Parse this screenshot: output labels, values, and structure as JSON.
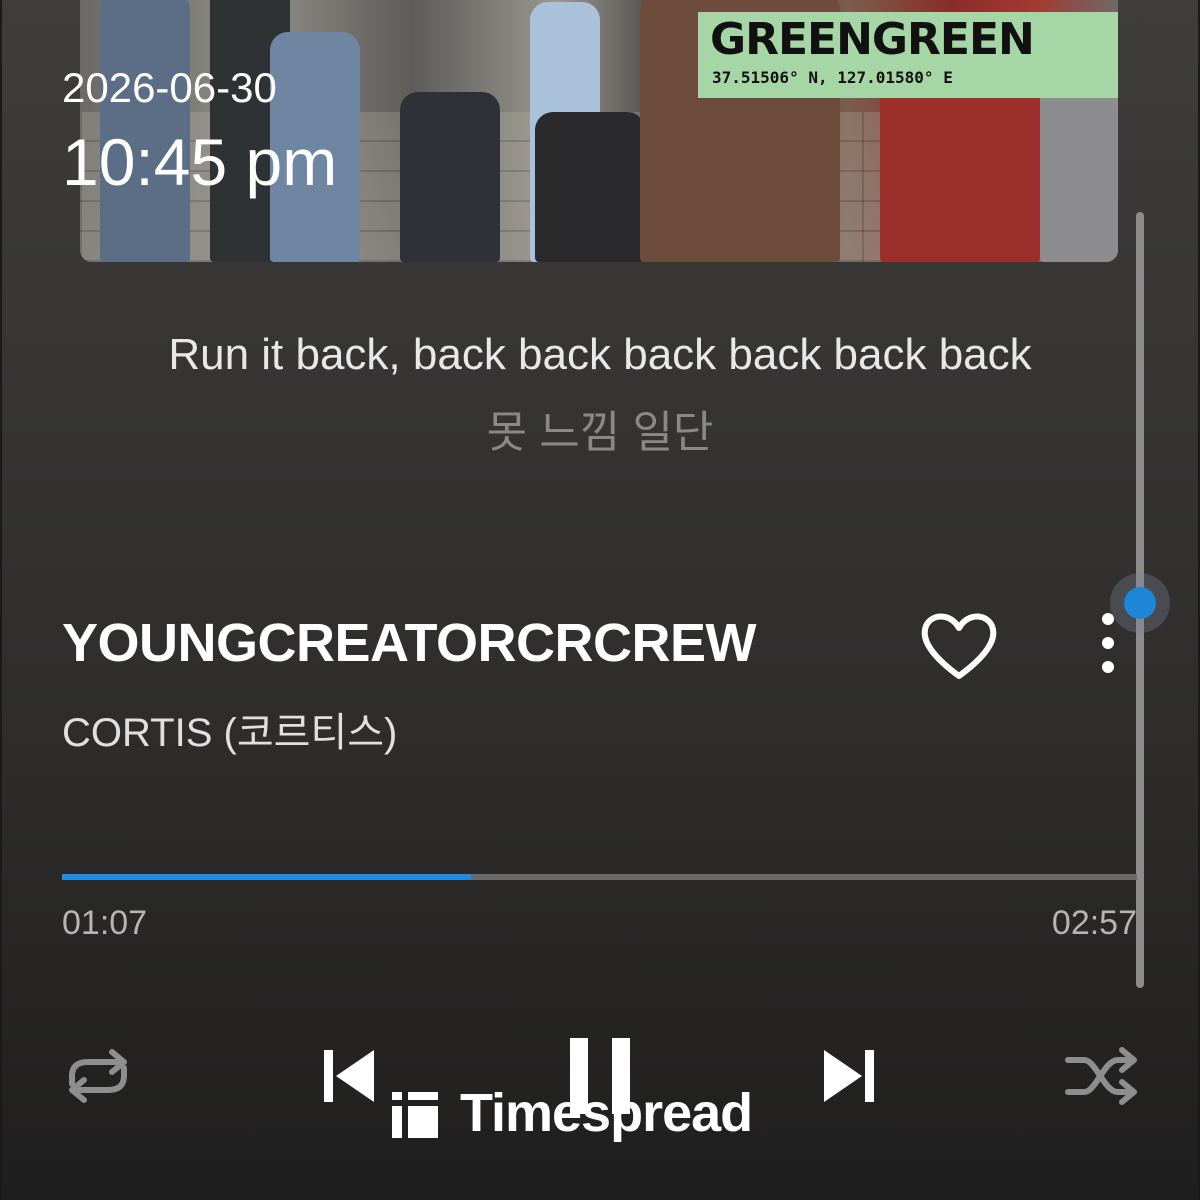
{
  "status": {
    "date": "2026-06-30",
    "time": "10:45 pm"
  },
  "album_art": {
    "badge_title": "GREENGREEN",
    "badge_coords": "37.51506° N, 127.01580° E",
    "badge_color": "#a6d6a5"
  },
  "lyrics": {
    "current": "Run it back, back back back back back back",
    "next": "못 느낌 일단"
  },
  "track": {
    "title": "YOUNGCREATORCRCREW",
    "artist": "CORTIS (코르티스)",
    "liked": false
  },
  "progress": {
    "elapsed": "01:07",
    "total": "02:57",
    "fraction": 0.38
  },
  "controls": [
    "repeat-icon",
    "previous-icon",
    "pause-icon",
    "next-icon",
    "shuffle-icon"
  ],
  "watermark": {
    "text": "Timespread"
  },
  "colors": {
    "accent": "#1e8de6",
    "text_primary": "#ffffff",
    "text_muted": "#8a8988"
  }
}
